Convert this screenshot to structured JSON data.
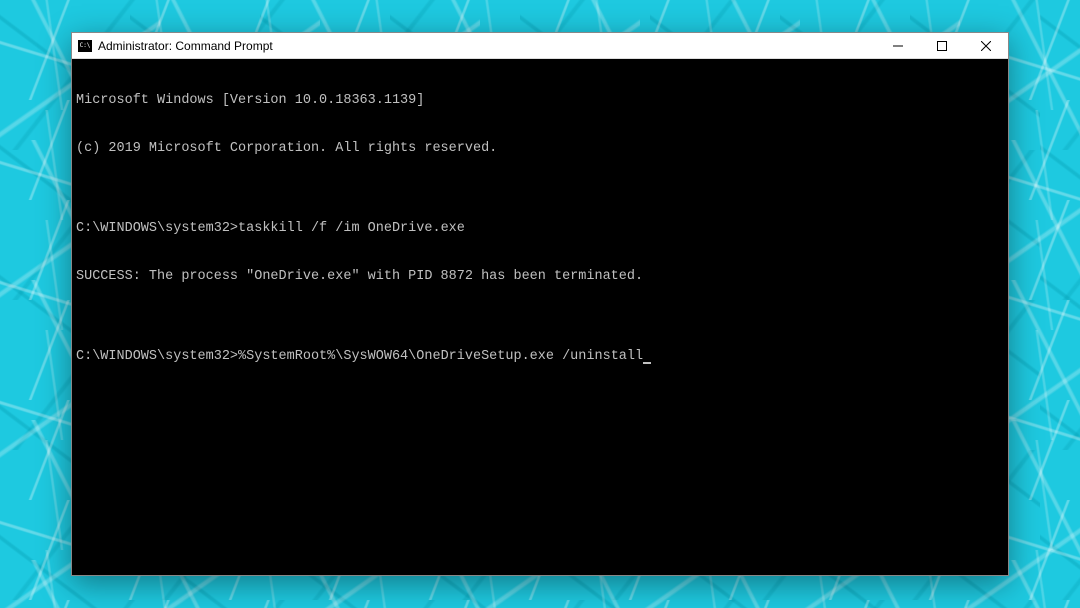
{
  "window": {
    "title": "Administrator: Command Prompt"
  },
  "terminal": {
    "line1": "Microsoft Windows [Version 10.0.18363.1139]",
    "line2": "(c) 2019 Microsoft Corporation. All rights reserved.",
    "blank1": "",
    "prompt1": "C:\\WINDOWS\\system32>",
    "cmd1": "taskkill /f /im OneDrive.exe",
    "result1": "SUCCESS: The process \"OneDrive.exe\" with PID 8872 has been terminated.",
    "blank2": "",
    "prompt2": "C:\\WINDOWS\\system32>",
    "cmd2": "%SystemRoot%\\SysWOW64\\OneDriveSetup.exe /uninstall"
  }
}
